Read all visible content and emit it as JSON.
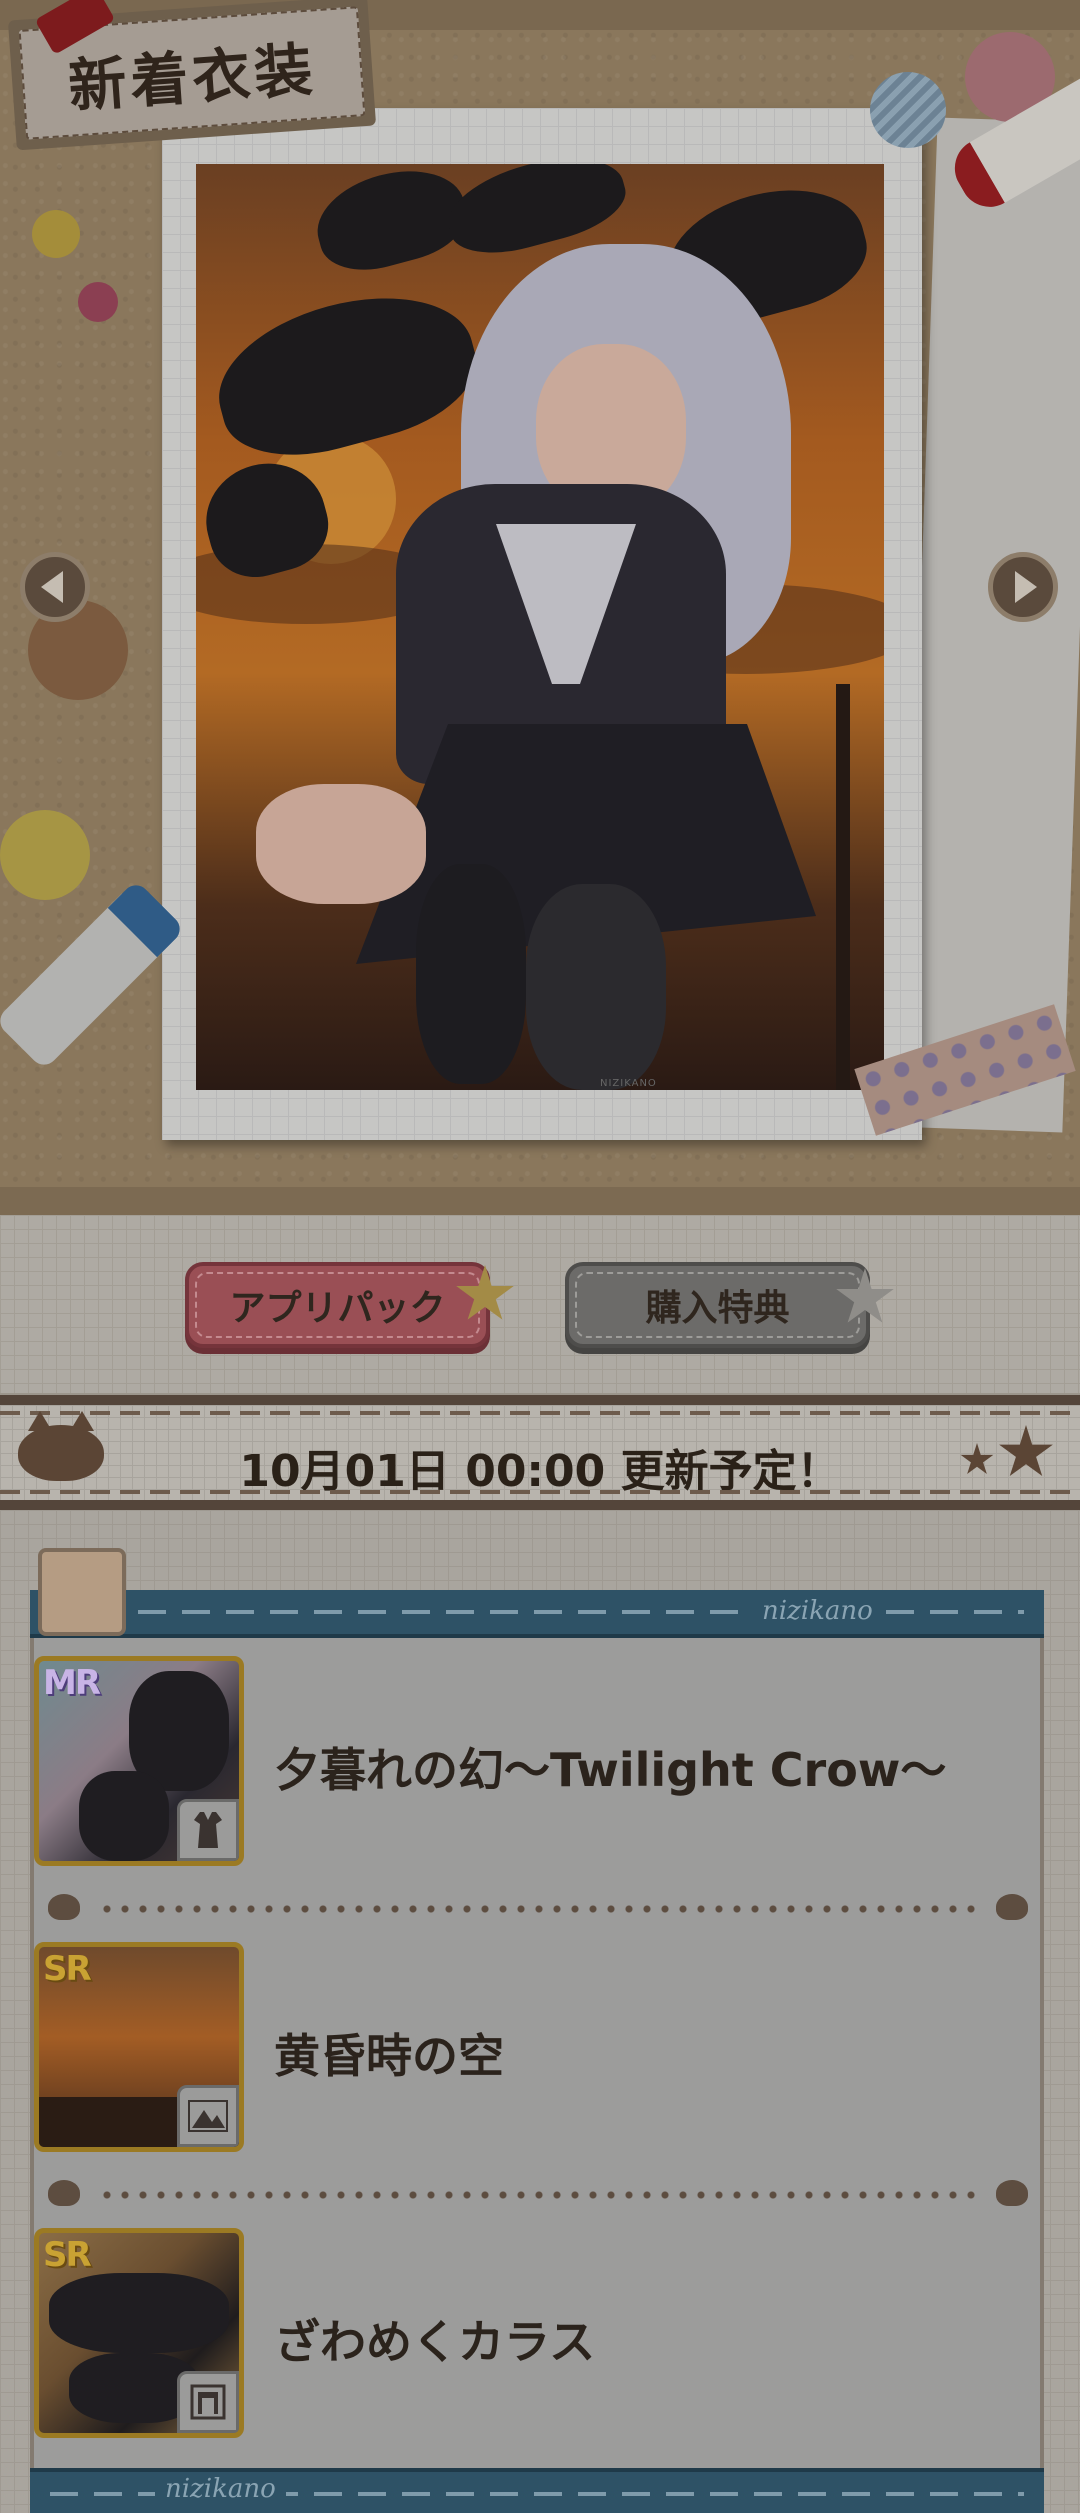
{
  "header": {
    "title": "新着衣装"
  },
  "hero": {
    "artwork_watermark": "NIZIKANO",
    "prev_icon": "triangle-left-icon",
    "next_icon": "triangle-right-icon"
  },
  "tabs": [
    {
      "label": "アプリパック",
      "active": true
    },
    {
      "label": "購入特典",
      "active": false
    }
  ],
  "banner": {
    "text": "10月01日 00:00 更新予定！"
  },
  "panel": {
    "brand_top": "nizikano",
    "brand_bottom": "nizikano"
  },
  "items": [
    {
      "name": "夕暮れの幻〜Twilight Crow〜",
      "rarity": "MR",
      "category_icon": "dress-icon"
    },
    {
      "name": "黄昏時の空",
      "rarity": "SR",
      "category_icon": "background-mountain-icon"
    },
    {
      "name": "ざわめくカラス",
      "rarity": "SR",
      "category_icon": "frame-icon"
    }
  ],
  "colors": {
    "panel_header": "#2e5266",
    "tab_active": "#9a4f55",
    "tab_inactive": "#6c6b69",
    "banner_border": "#54453a"
  }
}
